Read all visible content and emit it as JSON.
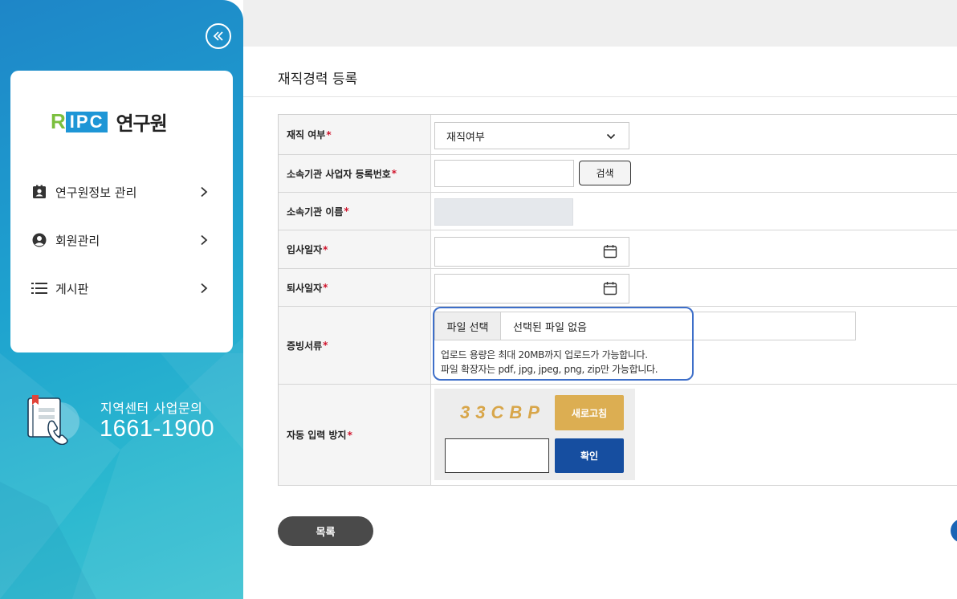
{
  "sidebar": {
    "brand": {
      "logo_letter": "R",
      "logo_box_text": "IPC",
      "name": "연구원"
    },
    "items": [
      {
        "label": "연구원정보 관리",
        "icon": "id-card-icon"
      },
      {
        "label": "회원관리",
        "icon": "user-circle-icon"
      },
      {
        "label": "게시판",
        "icon": "list-icon"
      }
    ],
    "contact": {
      "label": "지역센터 사업문의",
      "phone": "1661-1900"
    }
  },
  "page": {
    "title": "재직경력 등록"
  },
  "form": {
    "employment": {
      "label": "재직 여부",
      "required": "*",
      "selected": "재직여부"
    },
    "biz_number": {
      "label": "소속기관 사업자 등록번호",
      "required": "*",
      "value": "",
      "search_label": "검색"
    },
    "org_name": {
      "label": "소속기관 이름",
      "required": "*",
      "value": ""
    },
    "join_date": {
      "label": "입사일자",
      "required": "*",
      "value": ""
    },
    "leave_date": {
      "label": "퇴사일자",
      "required": "*",
      "value": ""
    },
    "evidence": {
      "label": "증빙서류",
      "required": "*",
      "file_button": "파일 선택",
      "file_status": "선택된 파일 없음",
      "help_line1": "업로드 용량은 최대 20MB까지 업로드가 가능합니다.",
      "help_line2": "파일 확장자는 pdf, jpg, jpeg, png, zip만 가능합니다."
    },
    "captcha": {
      "label": "자동 입력 방지",
      "required": "*",
      "code": "33CBP",
      "refresh_label": "새로고침",
      "confirm_label": "확인",
      "value": ""
    }
  },
  "footer": {
    "list_label": "목록"
  },
  "colors": {
    "accent_blue": "#164ea0",
    "refresh_gold": "#dcae52",
    "required_red": "#d0142c",
    "highlight_outline": "#3e6fc9",
    "sidebar_teal": "#1ea2cf"
  }
}
